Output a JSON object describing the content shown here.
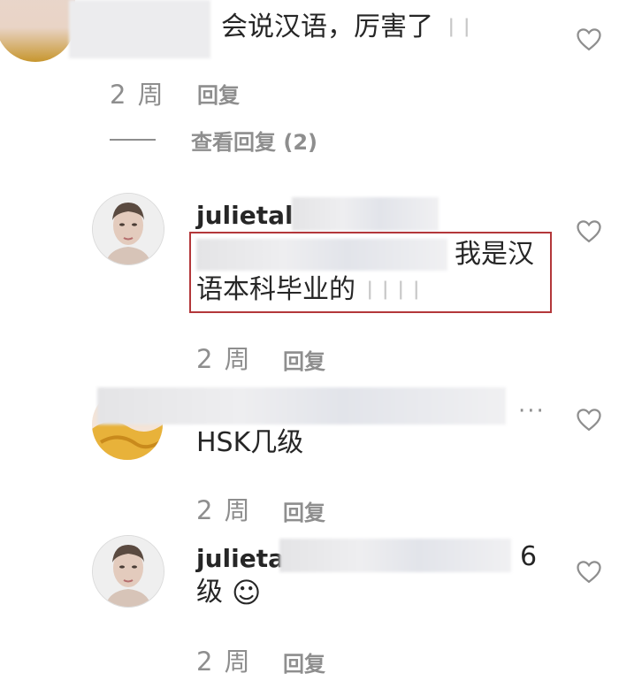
{
  "comments": [
    {
      "text": "会说汉语，厉害了",
      "time": "2 周",
      "reply_label": "回复",
      "view_replies": "查看回复 (2)"
    },
    {
      "username": "julietal",
      "text_line1": "我是汉",
      "text_line2": "语本科毕业的",
      "time": "2 周",
      "reply_label": "回复"
    },
    {
      "more": "···",
      "text": "HSK几级",
      "time": "2 周",
      "reply_label": "回复"
    },
    {
      "username": "julieta",
      "text_suffix": "6",
      "text_line2": "级",
      "emoji": "☺",
      "time": "2 周",
      "reply_label": "回复"
    }
  ],
  "icons": {
    "like": "heart-outline-icon",
    "more": "more-options-icon",
    "emoji": "smile-emoji-icon"
  },
  "colors": {
    "highlight_border": "#b3373a",
    "muted_text": "#8e8e8e",
    "text": "#262626"
  }
}
